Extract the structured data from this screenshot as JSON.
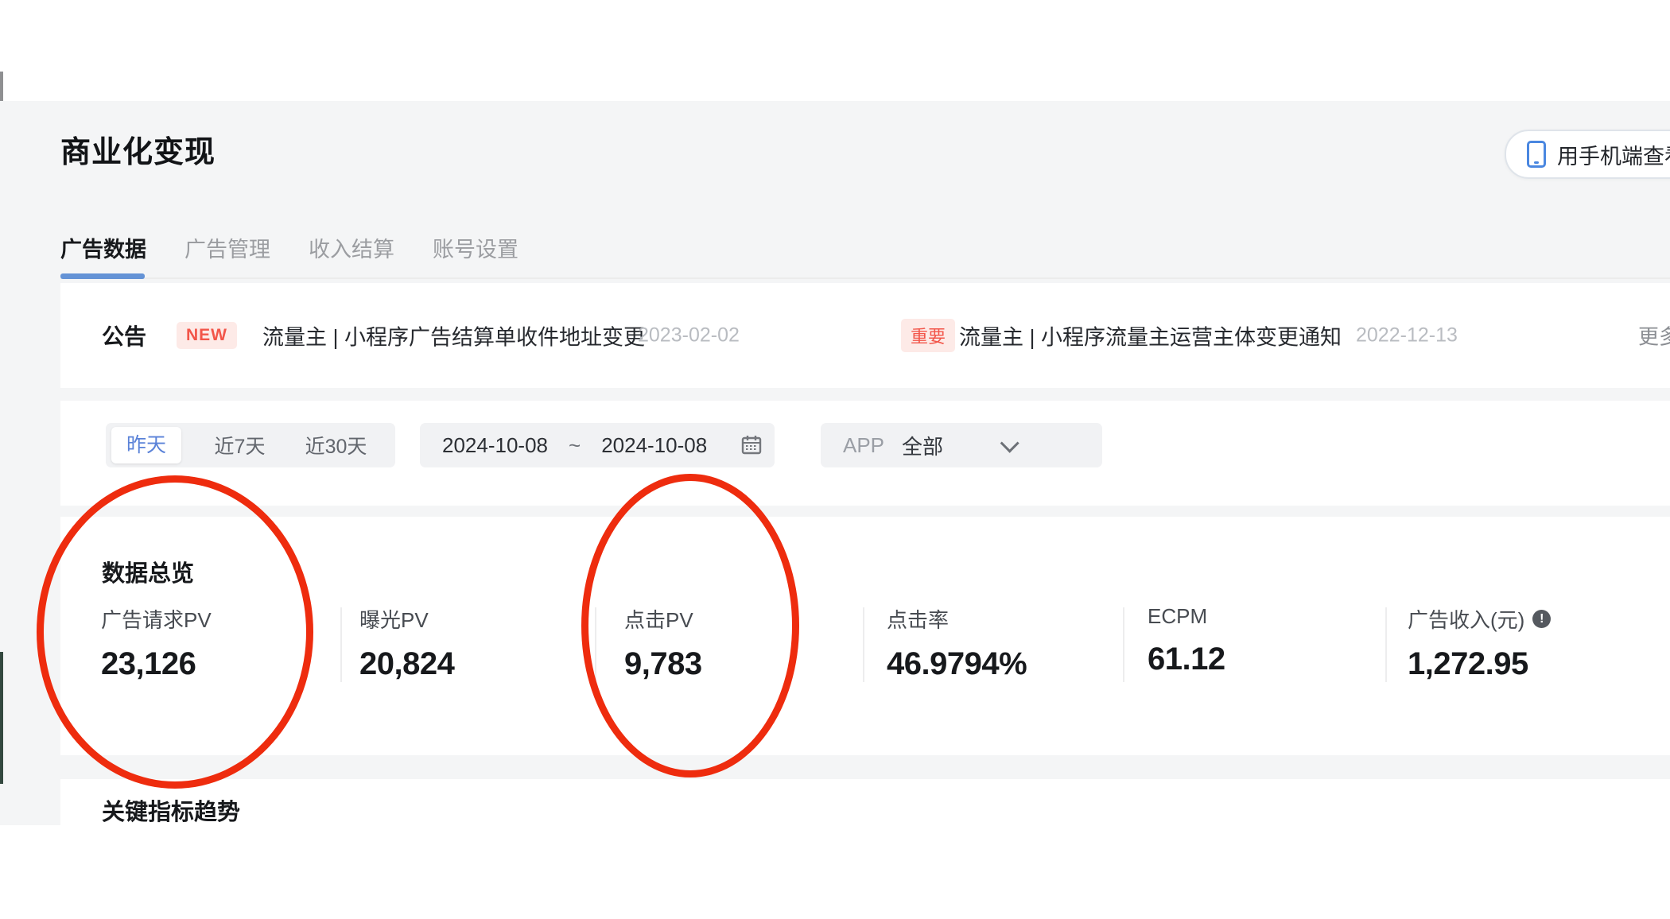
{
  "page": {
    "title": "商业化变现"
  },
  "header": {
    "mobile_button": {
      "label": "用手机端查看数据",
      "icon": "phone-icon"
    }
  },
  "tabs": [
    {
      "label": "广告数据",
      "active": true
    },
    {
      "label": "广告管理",
      "active": false
    },
    {
      "label": "收入结算",
      "active": false
    },
    {
      "label": "账号设置",
      "active": false
    }
  ],
  "announcement": {
    "title": "公告",
    "items": [
      {
        "badge": "NEW",
        "text": "流量主 | 小程序广告结算单收件地址变更",
        "date": "2023-02-02"
      },
      {
        "badge": "重要",
        "text": "流量主 | 小程序流量主运营主体变更通知",
        "date": "2022-12-13"
      }
    ],
    "more_label": "更多"
  },
  "filters": {
    "quick_ranges": [
      {
        "label": "昨天",
        "selected": true
      },
      {
        "label": "近7天",
        "selected": false
      },
      {
        "label": "近30天",
        "selected": false
      }
    ],
    "date_range": {
      "start": "2024-10-08",
      "separator": "~",
      "end": "2024-10-08",
      "icon": "calendar-icon"
    },
    "app_filter": {
      "label": "APP",
      "value": "全部",
      "icon": "chevron-down-icon"
    }
  },
  "overview": {
    "title": "数据总览",
    "metrics": [
      {
        "label": "广告请求PV",
        "value": "23,126"
      },
      {
        "label": "曝光PV",
        "value": "20,824"
      },
      {
        "label": "点击PV",
        "value": "9,783"
      },
      {
        "label": "点击率",
        "value": "46.9794%"
      },
      {
        "label": "ECPM",
        "value": "61.12"
      },
      {
        "label": "广告收入(元)",
        "value": "1,272.95",
        "info_icon": "!"
      }
    ]
  },
  "trend": {
    "title": "关键指标趋势"
  },
  "annotations": {
    "circled_metrics": [
      "广告请求PV",
      "点击PV"
    ],
    "color": "#ee2c0e"
  },
  "colors": {
    "accent_blue": "#5a82d8",
    "tab_underline_blue": "#6493d6",
    "badge_red": "#f25549",
    "badge_bg": "#fdeae7",
    "page_bg": "#f4f5f6",
    "card_bg": "#ffffff"
  }
}
